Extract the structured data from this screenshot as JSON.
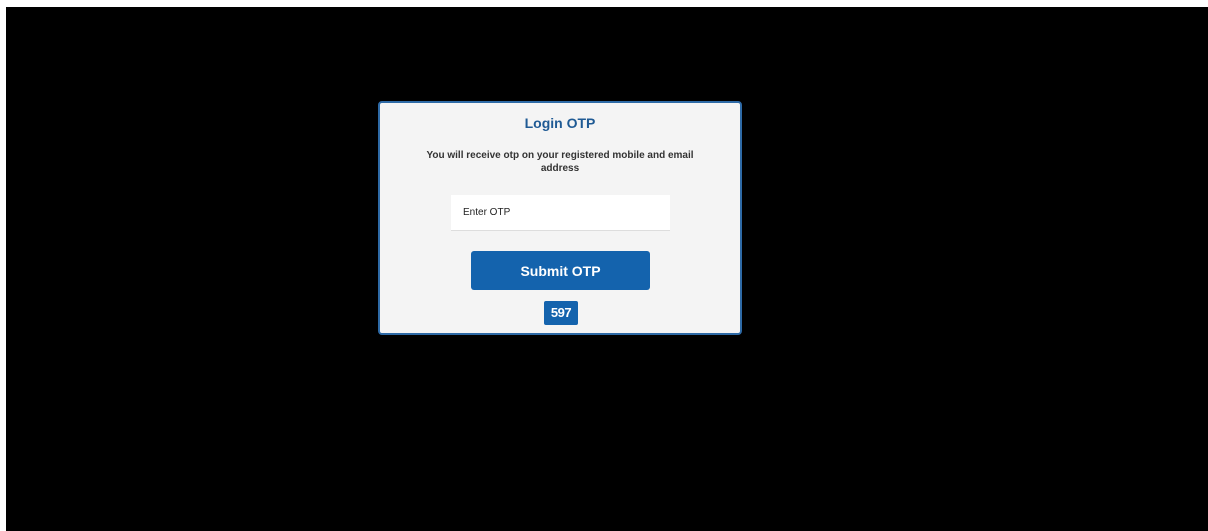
{
  "dialog": {
    "title": "Login OTP",
    "message": "You will receive otp on your registered mobile and email address",
    "otp_placeholder": "Enter OTP",
    "otp_value": "",
    "submit_label": "Submit OTP",
    "captcha_code": "597"
  },
  "colors": {
    "background": "#000000",
    "card_background": "#f4f4f4",
    "card_border": "#2e6aa6",
    "title_color": "#1f5a94",
    "accent": "#1463ad"
  }
}
